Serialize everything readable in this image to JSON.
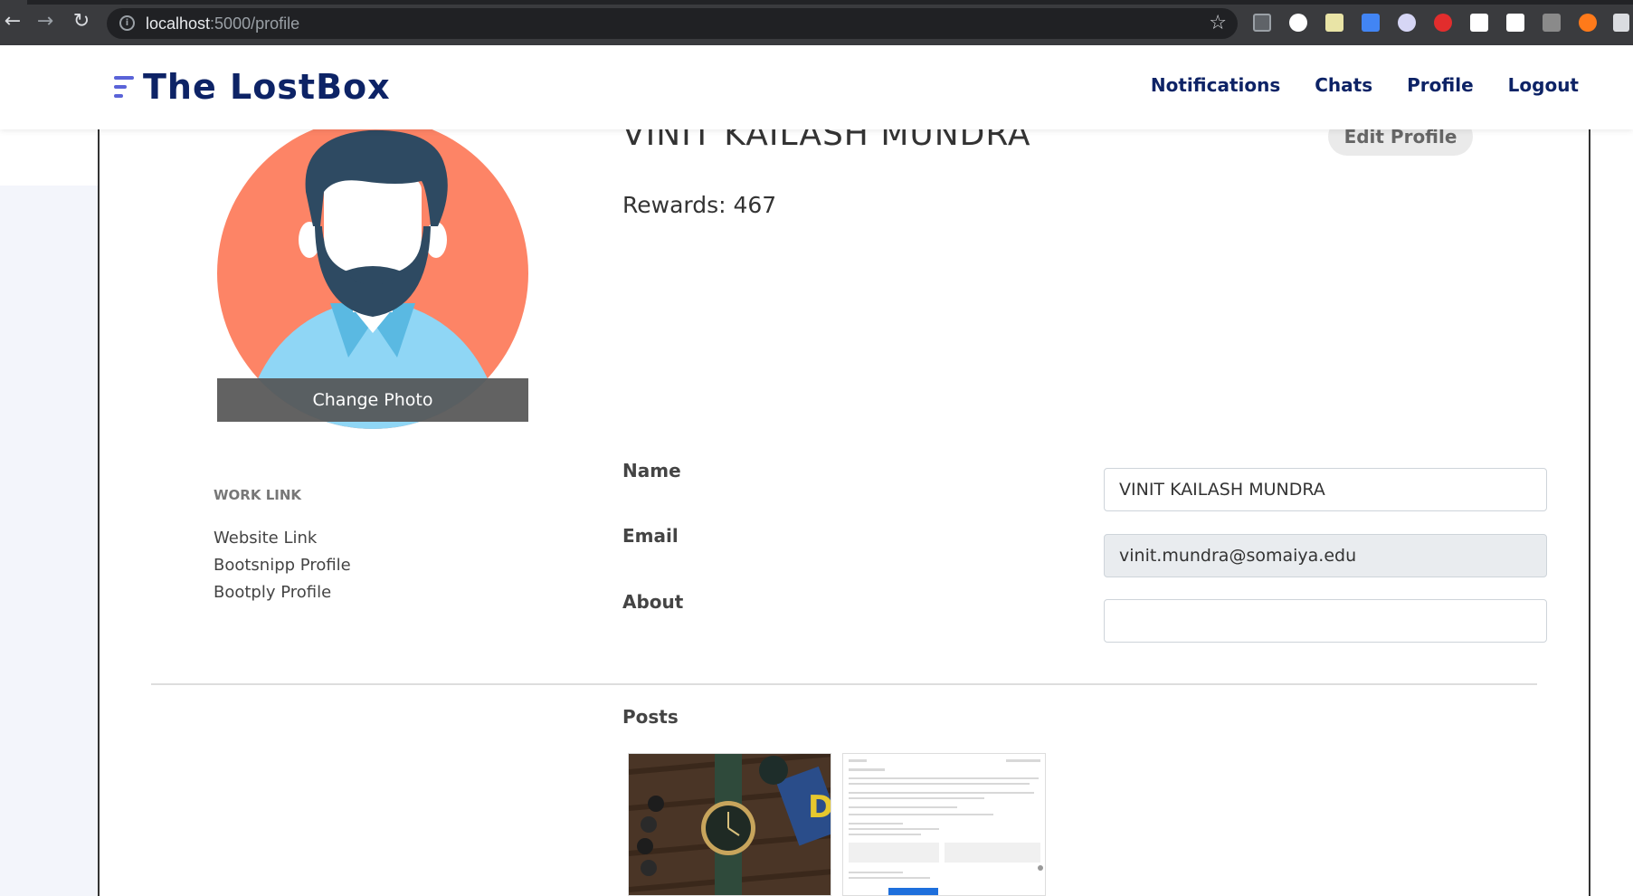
{
  "browser": {
    "url_host": "localhost",
    "url_path": ":5000/profile"
  },
  "navbar": {
    "brand": "The LostBox",
    "links": [
      "Notifications",
      "Chats",
      "Profile",
      "Logout"
    ]
  },
  "profile": {
    "name": "VINIT KAILASH MUNDRA",
    "rewards": "Rewards: 467",
    "edit_label": "Edit Profile",
    "change_photo_label": "Change Photo"
  },
  "work": {
    "title": "WORK LINK",
    "links": [
      "Website Link",
      "Bootsnipp Profile",
      "Bootply Profile"
    ]
  },
  "fields": {
    "name_label": "Name",
    "name_value": "VINIT KAILASH MUNDRA",
    "email_label": "Email",
    "email_value": "vinit.mundra@somaiya.edu",
    "about_label": "About",
    "about_value": ""
  },
  "posts": {
    "title": "Posts"
  },
  "colors": {
    "brand_navy": "#0d2366",
    "brand_accent": "#5a63d8",
    "avatar_bg": "#fd8466",
    "hair": "#2e4a62",
    "shirt": "#8fd6f5"
  }
}
